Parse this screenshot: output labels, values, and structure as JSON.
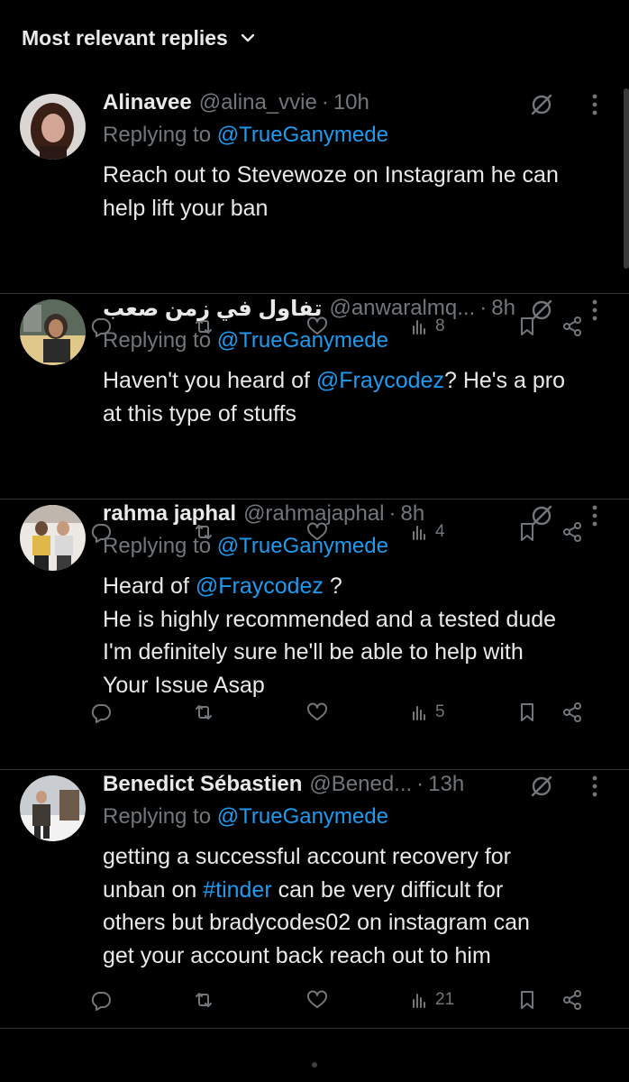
{
  "header": {
    "sort_label": "Most relevant replies"
  },
  "replying_prefix": "Replying to",
  "replies": [
    {
      "name": "Alinavee",
      "handle": "@alina_vvie",
      "time": "10h",
      "replying_to": "@TrueGanymede",
      "lines": [
        [
          {
            "t": "Reach out to Stevewoze on Instagram he can"
          }
        ],
        [
          {
            "t": "help lift your ban"
          }
        ]
      ],
      "views": "8"
    },
    {
      "name": "تفاول في زمن صعب",
      "handle": "@anwaralmq...",
      "time": "8h",
      "replying_to": "@TrueGanymede",
      "lines": [
        [
          {
            "t": "Haven't you heard of "
          },
          {
            "t": "@Fraycodez",
            "link": true
          },
          {
            "t": "? He's a pro"
          }
        ],
        [
          {
            "t": "at this type of stuffs"
          }
        ]
      ],
      "views": "4"
    },
    {
      "name": "rahma japhal",
      "handle": "@rahmajaphal",
      "time": "8h",
      "replying_to": "@TrueGanymede",
      "lines": [
        [
          {
            "t": "Heard of "
          },
          {
            "t": "@Fraycodez",
            "link": true
          },
          {
            "t": " ?"
          }
        ],
        [
          {
            "t": "He is highly recommended and a tested dude"
          }
        ],
        [
          {
            "t": "I'm definitely sure he'll be able to help with"
          }
        ],
        [
          {
            "t": "Your Issue Asap"
          }
        ]
      ],
      "views": "5"
    },
    {
      "name": "Benedict Sébastien",
      "handle": "@Bened...",
      "time": "13h",
      "replying_to": "@TrueGanymede",
      "lines": [
        [
          {
            "t": "getting a successful account recovery for"
          }
        ],
        [
          {
            "t": "unban on "
          },
          {
            "t": "#tinder",
            "link": true
          },
          {
            "t": " can be very difficult for"
          }
        ],
        [
          {
            "t": "others but bradycodes02 on instagram can"
          }
        ],
        [
          {
            "t": "get your account back reach out to him"
          }
        ]
      ],
      "views": "21"
    }
  ],
  "icons": {
    "reply": "reply-icon",
    "repost": "repost-icon",
    "like": "like-icon",
    "views": "views-icon",
    "bookmark": "bookmark-icon",
    "share": "share-icon",
    "grok": "grok-icon",
    "more": "more-icon",
    "sort": "chevron-down-icon"
  },
  "colors": {
    "background": "#000000",
    "text": "#e7e9ea",
    "muted": "#71767b",
    "link": "#1d9bf0",
    "divider": "#2f3336"
  }
}
